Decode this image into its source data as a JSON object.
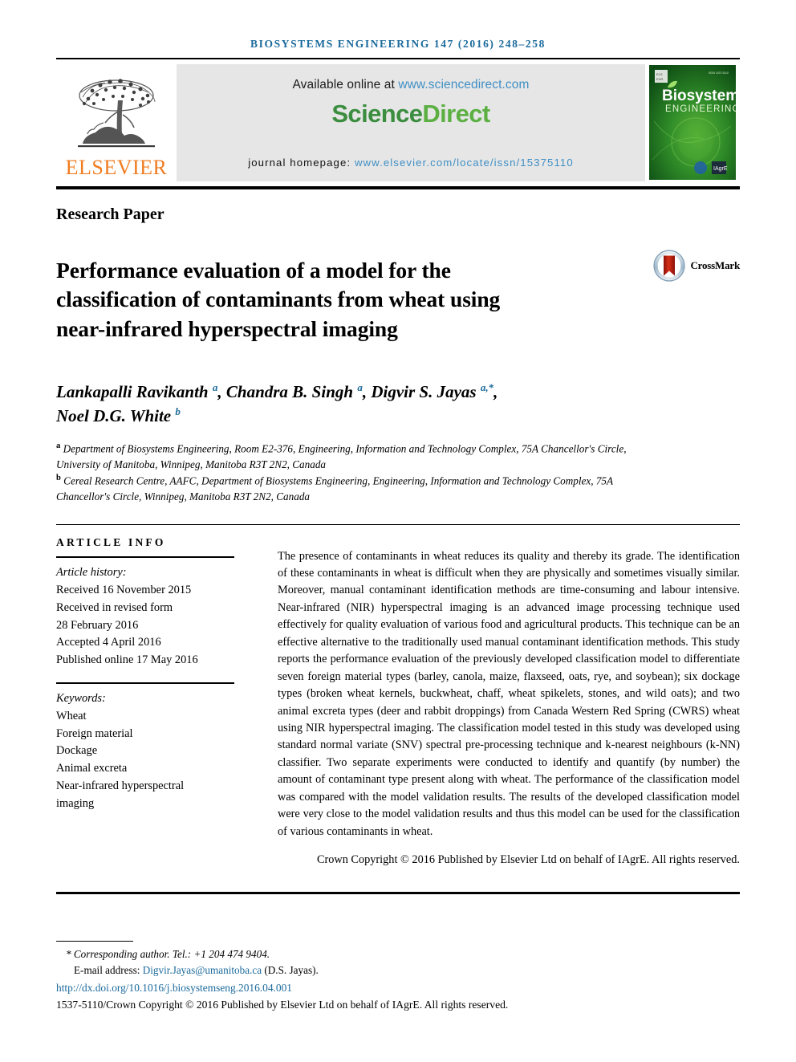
{
  "running_head": "BIOSYSTEMS ENGINEERING 147 (2016) 248–258",
  "masthead": {
    "publisher_name": "ELSEVIER",
    "available_prefix": "Available online at ",
    "sciencedirect_url": "www.sciencedirect.com",
    "sciencedirect_logo_a": "Science",
    "sciencedirect_logo_b": "Direct",
    "homepage_prefix": "journal homepage: ",
    "homepage_url": "www.elsevier.com/locate/issn/15375110",
    "cover_title_line1": "Biosystems",
    "cover_title_line2": "ENGINEERING"
  },
  "article_type": "Research Paper",
  "title": "Performance evaluation of a model for the classification of contaminants from wheat using near-infrared hyperspectral imaging",
  "crossmark_label": "CrossMark",
  "authors_line1_a": "Lankapalli Ravikanth ",
  "authors_sup_a1": "a",
  "authors_line1_b": ", Chandra B. Singh ",
  "authors_sup_a2": "a",
  "authors_line1_c": ", Digvir S. Jayas ",
  "authors_sup_a3": "a,*",
  "authors_line1_d": ",",
  "authors_line2": "Noel D.G. White ",
  "authors_sup_b": "b",
  "affiliations": [
    {
      "marker": "a",
      "text": "Department of Biosystems Engineering, Room E2-376, Engineering, Information and Technology Complex, 75A Chancellor's Circle, University of Manitoba, Winnipeg, Manitoba R3T 2N2, Canada"
    },
    {
      "marker": "b",
      "text": "Cereal Research Centre, AAFC, Department of Biosystems Engineering, Engineering, Information and Technology Complex, 75A Chancellor's Circle, Winnipeg, Manitoba R3T 2N2, Canada"
    }
  ],
  "article_info": {
    "heading": "ARTICLE INFO",
    "history_label": "Article history:",
    "history": [
      "Received 16 November 2015",
      "Received in revised form",
      "28 February 2016",
      "Accepted 4 April 2016",
      "Published online 17 May 2016"
    ],
    "keywords_label": "Keywords:",
    "keywords": [
      "Wheat",
      "Foreign material",
      "Dockage",
      "Animal excreta",
      "Near-infrared hyperspectral",
      "imaging"
    ]
  },
  "abstract": "The presence of contaminants in wheat reduces its quality and thereby its grade. The identification of these contaminants in wheat is difficult when they are physically and sometimes visually similar. Moreover, manual contaminant identification methods are time-consuming and labour intensive. Near-infrared (NIR) hyperspectral imaging is an advanced image processing technique used effectively for quality evaluation of various food and agricultural products. This technique can be an effective alternative to the traditionally used manual contaminant identification methods. This study reports the performance evaluation of the previously developed classification model to differentiate seven foreign material types (barley, canola, maize, flaxseed, oats, rye, and soybean); six dockage types (broken wheat kernels, buckwheat, chaff, wheat spikelets, stones, and wild oats); and two animal excreta types (deer and rabbit droppings) from Canada Western Red Spring (CWRS) wheat using NIR hyperspectral imaging. The classification model tested in this study was developed using standard normal variate (SNV) spectral pre-processing technique and k-nearest neighbours (k-NN) classifier. Two separate experiments were conducted to identify and quantify (by number) the amount of contaminant type present along with wheat. The performance of the classification model was compared with the model validation results. The results of the developed classification model were very close to the model validation results and thus this model can be used for the classification of various contaminants in wheat.",
  "abstract_copyright": "Crown Copyright © 2016 Published by Elsevier Ltd on behalf of IAgrE. All rights reserved.",
  "footnotes": {
    "corresponding": "* Corresponding author. Tel.: +1 204 474 9404.",
    "email_label": "E-mail address: ",
    "email": "Digvir.Jayas@umanitoba.ca",
    "email_suffix": " (D.S. Jayas).",
    "doi": "http://dx.doi.org/10.1016/j.biosystemseng.2016.04.001",
    "issn_line": "1537-5110/Crown Copyright © 2016 Published by Elsevier Ltd on behalf of IAgrE. All rights reserved."
  },
  "colors": {
    "link_blue": "#1b6a9c",
    "sd_url_blue": "#3f8fc4",
    "elsevier_orange": "#ef7d22",
    "science_green": "#3b8d3f",
    "direct_green": "#5cb043",
    "band_grey": "#e6e6e6",
    "cover_green": "#2d7a2a"
  }
}
